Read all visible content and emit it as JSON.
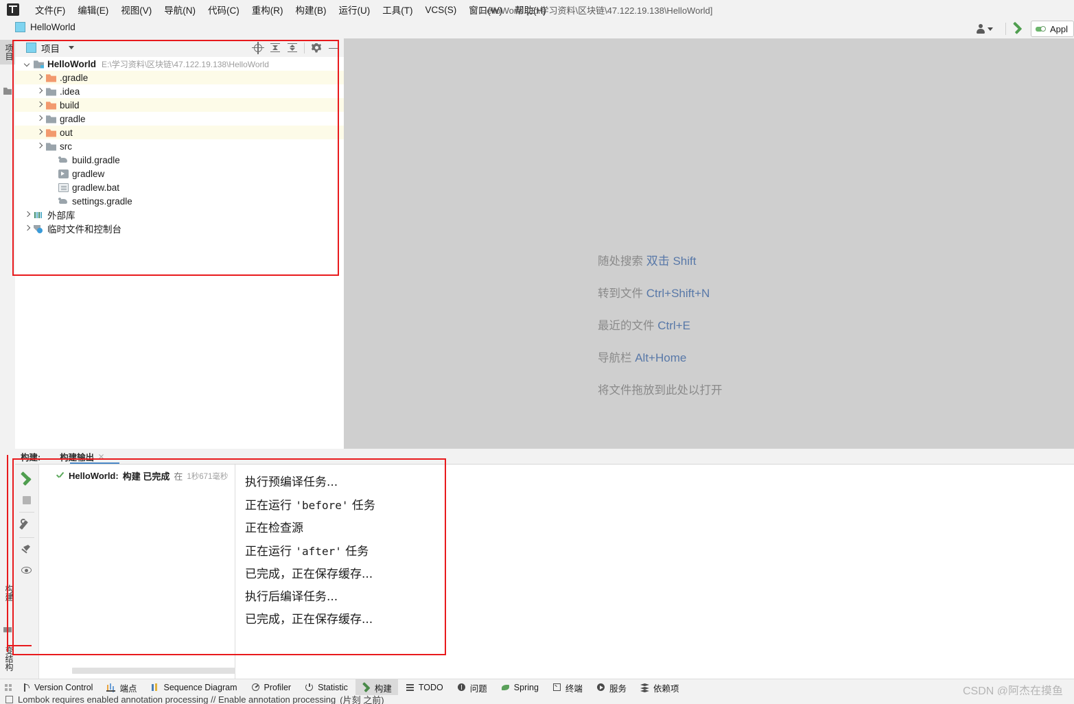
{
  "window": {
    "title": "HelloWorld [E:\\学习资料\\区块链\\47.122.19.138\\HelloWorld]",
    "tab_label": "HelloWorld"
  },
  "menubar": {
    "items": [
      {
        "label": "文件(F)"
      },
      {
        "label": "编辑(E)"
      },
      {
        "label": "视图(V)"
      },
      {
        "label": "导航(N)"
      },
      {
        "label": "代码(C)"
      },
      {
        "label": "重构(R)"
      },
      {
        "label": "构建(B)"
      },
      {
        "label": "运行(U)"
      },
      {
        "label": "工具(T)"
      },
      {
        "label": "VCS(S)"
      },
      {
        "label": "窗口(W)"
      },
      {
        "label": "帮助(H)"
      }
    ]
  },
  "toolbar_right": {
    "run_config_label": "Appl"
  },
  "left_stripe": {
    "project_tab": "项目",
    "build_tab": "构建",
    "structure_tab": "变结构"
  },
  "project_panel": {
    "title": "项目",
    "tree": [
      {
        "indent": 0,
        "arrow": "open",
        "icon": "mod",
        "name": "HelloWorld",
        "bold": true,
        "path": "E:\\学习资料\\区块链\\47.122.19.138\\HelloWorld",
        "alt": false
      },
      {
        "indent": 1,
        "arrow": "collapsed",
        "icon": "folder-o",
        "name": ".gradle",
        "bold": false,
        "path": "",
        "alt": true
      },
      {
        "indent": 1,
        "arrow": "collapsed",
        "icon": "folder-g",
        "name": ".idea",
        "bold": false,
        "path": "",
        "alt": false
      },
      {
        "indent": 1,
        "arrow": "collapsed",
        "icon": "folder-o",
        "name": "build",
        "bold": false,
        "path": "",
        "alt": true
      },
      {
        "indent": 1,
        "arrow": "collapsed",
        "icon": "folder-g",
        "name": "gradle",
        "bold": false,
        "path": "",
        "alt": false
      },
      {
        "indent": 1,
        "arrow": "collapsed",
        "icon": "folder-o",
        "name": "out",
        "bold": false,
        "path": "",
        "alt": true
      },
      {
        "indent": 1,
        "arrow": "collapsed",
        "icon": "folder-g",
        "name": "src",
        "bold": false,
        "path": "",
        "alt": false
      },
      {
        "indent": 2,
        "arrow": "none",
        "icon": "gradle",
        "name": "build.gradle",
        "bold": false,
        "path": "",
        "alt": false
      },
      {
        "indent": 2,
        "arrow": "none",
        "icon": "script",
        "name": "gradlew",
        "bold": false,
        "path": "",
        "alt": false
      },
      {
        "indent": 2,
        "arrow": "none",
        "icon": "bat",
        "name": "gradlew.bat",
        "bold": false,
        "path": "",
        "alt": false
      },
      {
        "indent": 2,
        "arrow": "none",
        "icon": "gradle",
        "name": "settings.gradle",
        "bold": false,
        "path": "",
        "alt": false
      },
      {
        "indent": 0,
        "arrow": "collapsed",
        "icon": "lib",
        "name": "外部库",
        "bold": false,
        "path": "",
        "alt": false
      },
      {
        "indent": 0,
        "arrow": "collapsed",
        "icon": "scratch",
        "name": "临时文件和控制台",
        "bold": false,
        "path": "",
        "alt": false
      }
    ]
  },
  "editor": {
    "hints": [
      {
        "label": "随处搜索",
        "key": "双击 Shift"
      },
      {
        "label": "转到文件",
        "key": "Ctrl+Shift+N"
      },
      {
        "label": "最近的文件",
        "key": "Ctrl+E"
      },
      {
        "label": "导航栏",
        "key": "Alt+Home"
      }
    ],
    "drop_hint": "将文件拖放到此处以打开"
  },
  "build_panel": {
    "title": "构建:",
    "tab_label": "构建输出",
    "result": {
      "project": "HelloWorld:",
      "action": "构建 已完成",
      "in_label": "在",
      "duration": "1秒671毫秒"
    },
    "console_lines": [
      "执行预编译任务...",
      "正在运行 'before' 任务",
      "正在检查源",
      "正在运行 'after' 任务",
      "已完成，正在保存缓存...",
      "执行后编译任务...",
      "已完成，正在保存缓存..."
    ]
  },
  "status_bar": {
    "items": [
      {
        "label": "Version Control",
        "icon": "ic-vcs",
        "active": false
      },
      {
        "label": "端点",
        "icon": "ic-endpoint",
        "active": false
      },
      {
        "label": "Sequence Diagram",
        "icon": "ic-seq",
        "active": false
      },
      {
        "label": "Profiler",
        "icon": "ic-profiler",
        "active": false
      },
      {
        "label": "Statistic",
        "icon": "ic-stat",
        "active": false
      },
      {
        "label": "构建",
        "icon": "ic-build",
        "active": true
      },
      {
        "label": "TODO",
        "icon": "ic-todo",
        "active": false
      },
      {
        "label": "问题",
        "icon": "ic-problem",
        "active": false
      },
      {
        "label": "Spring",
        "icon": "ic-spring",
        "active": false
      },
      {
        "label": "终端",
        "icon": "ic-terminal",
        "active": false
      },
      {
        "label": "服务",
        "icon": "ic-services",
        "active": false
      },
      {
        "label": "依赖项",
        "icon": "ic-dep",
        "active": false
      }
    ],
    "watermark": "CSDN @阿杰在摸鱼"
  },
  "notification": {
    "text": "Lombok requires enabled annotation processing // Enable annotation processing",
    "time": "(片刻 之前)"
  }
}
